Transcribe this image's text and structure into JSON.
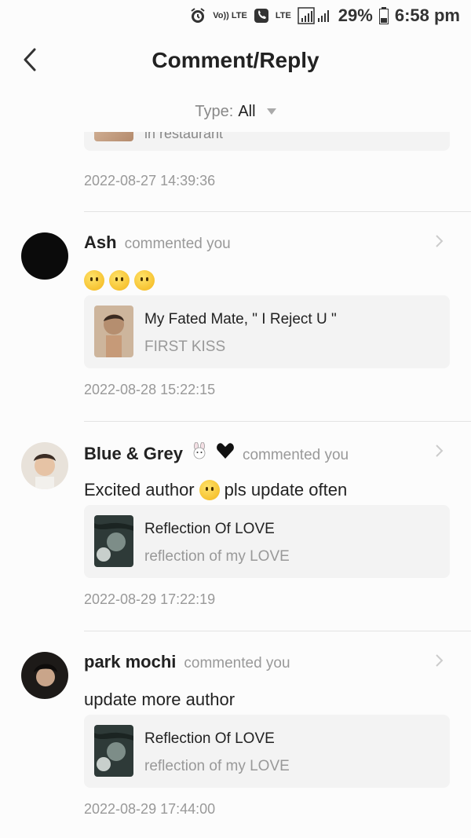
{
  "status_bar": {
    "volte": "Vo)) LTE",
    "lte": "LTE",
    "battery": "29%",
    "time": "6:58 pm"
  },
  "header": {
    "title": "Comment/Reply"
  },
  "filter": {
    "label": "Type:",
    "value": "All"
  },
  "partial": {
    "snippet": "in restaurant",
    "date": "2022-08-27 14:39:36"
  },
  "items": [
    {
      "username": "Ash",
      "action": "commented you",
      "comment": "",
      "story_title": "My Fated Mate, \" I Reject U \"",
      "story_sub": "FIRST KISS",
      "date": "2022-08-28 15:22:15"
    },
    {
      "username": "Blue & Grey",
      "action": "commented you",
      "comment_a": "Excited author",
      "comment_b": "pls update often",
      "story_title": "Reflection Of LOVE",
      "story_sub": "reflection of my LOVE",
      "date": "2022-08-29 17:22:19"
    },
    {
      "username": "park mochi",
      "action": "commented you",
      "comment": "update more author",
      "story_title": "Reflection Of LOVE",
      "story_sub": "reflection of my LOVE",
      "date": "2022-08-29 17:44:00"
    }
  ],
  "colors": {
    "background": "#fcfcfc",
    "card": "#f3f3f3",
    "muted_text": "#999999"
  }
}
